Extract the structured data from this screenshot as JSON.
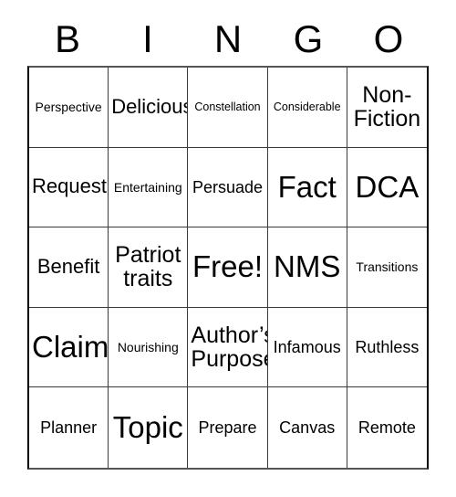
{
  "card": {
    "title_letters": [
      "B",
      "I",
      "N",
      "G",
      "O"
    ],
    "free_space_label": "Free!",
    "colors": {
      "background": "#ffffff",
      "text": "#000000",
      "grid_line": "#3a3a3a",
      "outer_border": "#555555"
    },
    "rows": [
      [
        {
          "text": "Perspective",
          "size": "sm"
        },
        {
          "text": "Delicious",
          "size": "lg"
        },
        {
          "text": "Constellation",
          "size": "xs"
        },
        {
          "text": "Considerable",
          "size": "xs"
        },
        {
          "text": "Non-\nFiction",
          "size": "xl"
        }
      ],
      [
        {
          "text": "Request",
          "size": "lg"
        },
        {
          "text": "Entertaining",
          "size": "sm"
        },
        {
          "text": "Persuade",
          "size": "md"
        },
        {
          "text": "Fact",
          "size": "xxl"
        },
        {
          "text": "DCA",
          "size": "xxl"
        }
      ],
      [
        {
          "text": "Benefit",
          "size": "lg"
        },
        {
          "text": "Patriot\ntraits",
          "size": "xl"
        },
        {
          "text": "Free!",
          "size": "xxl"
        },
        {
          "text": "NMS",
          "size": "xxl"
        },
        {
          "text": "Transitions",
          "size": "sm"
        }
      ],
      [
        {
          "text": "Claim",
          "size": "xxl"
        },
        {
          "text": "Nourishing",
          "size": "sm"
        },
        {
          "text": "Author’s\nPurpose",
          "size": "xl"
        },
        {
          "text": "Infamous",
          "size": "md"
        },
        {
          "text": "Ruthless",
          "size": "md"
        }
      ],
      [
        {
          "text": "Planner",
          "size": "md"
        },
        {
          "text": "Topic",
          "size": "xxl"
        },
        {
          "text": "Prepare",
          "size": "md"
        },
        {
          "text": "Canvas",
          "size": "md"
        },
        {
          "text": "Remote",
          "size": "md"
        }
      ]
    ]
  }
}
